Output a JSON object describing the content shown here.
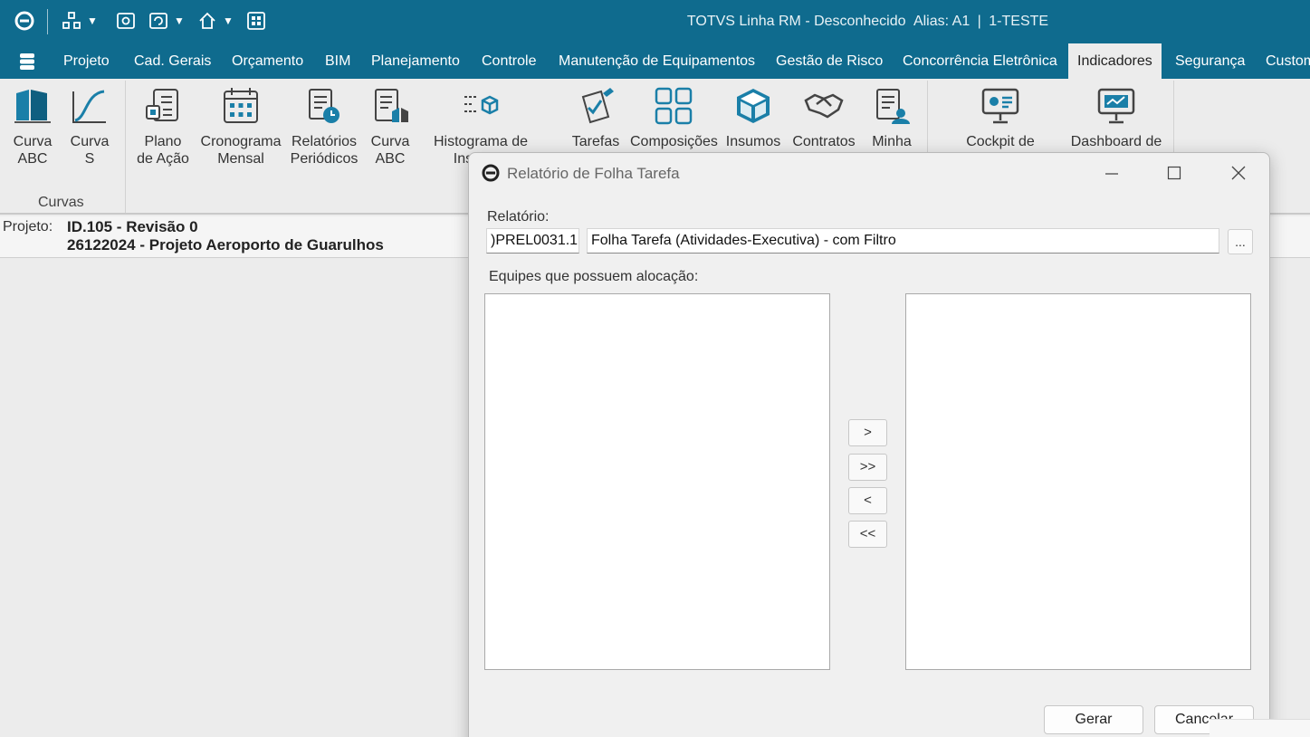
{
  "window": {
    "title_app": "TOTVS Linha RM - Desconhecido",
    "title_alias": "Alias: A1",
    "title_sep": "|",
    "title_context": "1-TESTE"
  },
  "menu": {
    "items": [
      "Projeto",
      "Cad. Gerais",
      "Orçamento",
      "BIM",
      "Planejamento",
      "Controle",
      "Manutenção de Equipamentos",
      "Gestão de Risco",
      "Concorrência Eletrônica",
      "Indicadores",
      "Segurança",
      "Custom"
    ],
    "active": "Indicadores"
  },
  "ribbon": {
    "group_curvas": "Curvas",
    "buttons": {
      "curva_abc": [
        "Curva",
        "ABC"
      ],
      "curva_s": [
        "Curva",
        "S"
      ],
      "plano_acao": [
        "Plano",
        "de Ação"
      ],
      "cronograma": [
        "Cronograma",
        "Mensal"
      ],
      "relatorios": [
        "Relatórios",
        "Periódicos"
      ],
      "curva_abc2": [
        "Curva",
        "ABC"
      ],
      "histograma": [
        "Histograma de",
        "Insumos"
      ],
      "tarefas": "Tarefas",
      "composicoes": "Composições",
      "insumos": "Insumos",
      "contratos": "Contratos",
      "minha": "Minha",
      "cockpit": "Cockpit de",
      "dashboard": "Dashboard de"
    }
  },
  "project": {
    "label": "Projeto:",
    "line1": "ID.105 - Revisão 0",
    "line2": "26122024 - Projeto Aeroporto de Guarulhos"
  },
  "dialog": {
    "title": "Relatório de Folha Tarefa",
    "report_label": "Relatório:",
    "report_code": ")PREL0031.1",
    "report_name": "Folha Tarefa (Atividades-Executiva) - com Filtro",
    "browse_label": "...",
    "teams_label": "Equipes que possuem alocação:",
    "move_one_right": ">",
    "move_all_right": ">>",
    "move_one_left": "<",
    "move_all_left": "<<",
    "generate_label": "Gerar",
    "cancel_label": "Cancelar"
  },
  "colors": {
    "titlebar": "#0f6b8e",
    "icon_blue": "#1a7fa8"
  }
}
